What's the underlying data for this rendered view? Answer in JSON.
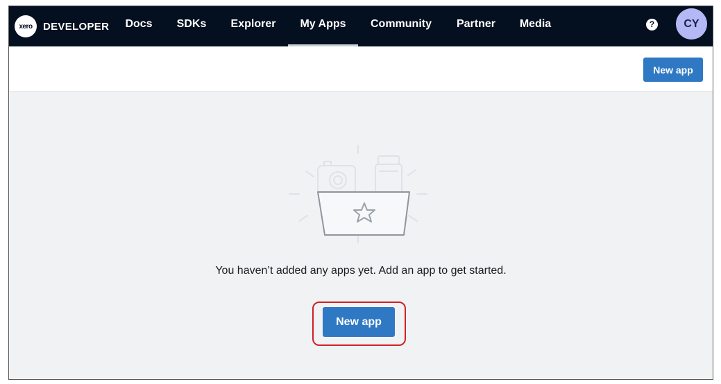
{
  "brand": {
    "logo_text": "xero",
    "name": "DEVELOPER"
  },
  "nav": {
    "items": [
      {
        "label": "Docs"
      },
      {
        "label": "SDKs"
      },
      {
        "label": "Explorer"
      },
      {
        "label": "My Apps",
        "active": true
      },
      {
        "label": "Community"
      },
      {
        "label": "Partner"
      },
      {
        "label": "Media"
      }
    ],
    "help_icon": "question-circle-icon",
    "help_glyph": "?",
    "avatar_initials": "CY"
  },
  "header": {
    "new_app_label": "New app"
  },
  "empty_state": {
    "illustration_icon": "folder-star-icon",
    "message": "You haven’t added any apps yet. Add an app to get started.",
    "new_app_label": "New app"
  },
  "colors": {
    "nav_bg": "#040f1f",
    "primary": "#2f78c4",
    "page_bg": "#f1f2f4",
    "avatar_bg": "#b4b8f4",
    "highlight": "#d11f26"
  }
}
